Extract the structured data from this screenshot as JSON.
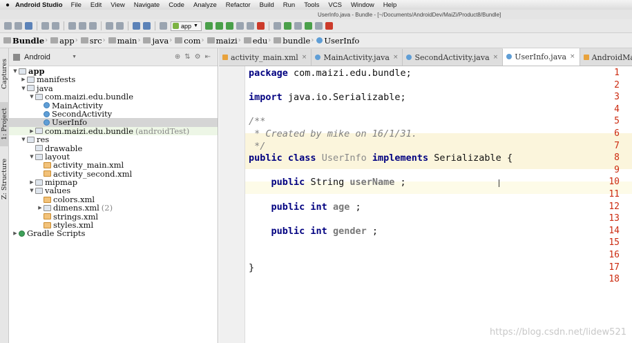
{
  "menubar": {
    "app_name": "Android Studio",
    "items": [
      "File",
      "Edit",
      "View",
      "Navigate",
      "Code",
      "Analyze",
      "Refactor",
      "Build",
      "Run",
      "Tools",
      "VCS",
      "Window",
      "Help"
    ]
  },
  "window_title": "UserInfo.java - Bundle - [~/Documents/AndroidDev/MaiZi/Product8/Bundle]",
  "toolbar": {
    "run_config": "app"
  },
  "breadcrumbs": [
    "Bundle",
    "app",
    "src",
    "main",
    "java",
    "com",
    "maizi",
    "edu",
    "bundle",
    "UserInfo"
  ],
  "side_tools": {
    "captures": "Captures",
    "project": "1: Project",
    "structure": "Z: Structure"
  },
  "project_panel": {
    "view_mode": "Android",
    "tree": [
      {
        "label": "app",
        "depth": 0,
        "arrow": "down",
        "icon": "folder",
        "bold": true
      },
      {
        "label": "manifests",
        "depth": 1,
        "arrow": "right",
        "icon": "folder"
      },
      {
        "label": "java",
        "depth": 1,
        "arrow": "down",
        "icon": "folder"
      },
      {
        "label": "com.maizi.edu.bundle",
        "depth": 2,
        "arrow": "down",
        "icon": "folder"
      },
      {
        "label": "MainActivity",
        "depth": 3,
        "arrow": "",
        "icon": "class"
      },
      {
        "label": "SecondActivity",
        "depth": 3,
        "arrow": "",
        "icon": "class"
      },
      {
        "label": "UserInfo",
        "depth": 3,
        "arrow": "",
        "icon": "class",
        "selected": true
      },
      {
        "label": "com.maizi.edu.bundle",
        "suffix": "(androidTest)",
        "depth": 2,
        "arrow": "right",
        "icon": "folder",
        "highlight": true
      },
      {
        "label": "res",
        "depth": 1,
        "arrow": "down",
        "icon": "folder"
      },
      {
        "label": "drawable",
        "depth": 2,
        "arrow": "",
        "icon": "folder"
      },
      {
        "label": "layout",
        "depth": 2,
        "arrow": "down",
        "icon": "folder"
      },
      {
        "label": "activity_main.xml",
        "depth": 3,
        "arrow": "",
        "icon": "xml"
      },
      {
        "label": "activity_second.xml",
        "depth": 3,
        "arrow": "",
        "icon": "xml"
      },
      {
        "label": "mipmap",
        "depth": 2,
        "arrow": "right",
        "icon": "folder"
      },
      {
        "label": "values",
        "depth": 2,
        "arrow": "down",
        "icon": "folder"
      },
      {
        "label": "colors.xml",
        "depth": 3,
        "arrow": "",
        "icon": "xml"
      },
      {
        "label": "dimens.xml",
        "suffix": "(2)",
        "depth": 3,
        "arrow": "right",
        "icon": "folder"
      },
      {
        "label": "strings.xml",
        "depth": 3,
        "arrow": "",
        "icon": "xml"
      },
      {
        "label": "styles.xml",
        "depth": 3,
        "arrow": "",
        "icon": "xml"
      },
      {
        "label": "Gradle Scripts",
        "depth": 0,
        "arrow": "right",
        "icon": "gradle"
      }
    ]
  },
  "editor": {
    "tabs": [
      {
        "label": "activity_main.xml",
        "icon": "xml",
        "active": false
      },
      {
        "label": "MainActivity.java",
        "icon": "class",
        "active": false
      },
      {
        "label": "SecondActivity.java",
        "icon": "class",
        "active": false
      },
      {
        "label": "UserInfo.java",
        "icon": "class",
        "active": true
      },
      {
        "label": "AndroidManifest.xml",
        "icon": "xml",
        "active": false
      }
    ],
    "lines": [
      {
        "n": "1",
        "tokens": [
          [
            "kw",
            "package"
          ],
          [
            "",
            "com.maizi.edu.bundle;"
          ]
        ]
      },
      {
        "n": "2",
        "tokens": []
      },
      {
        "n": "3",
        "tokens": [
          [
            "kw",
            "import"
          ],
          [
            "",
            "java.io.Serializable;"
          ]
        ]
      },
      {
        "n": "4",
        "tokens": []
      },
      {
        "n": "5",
        "tokens": [
          [
            "cmt",
            "/**"
          ]
        ]
      },
      {
        "n": "6",
        "tokens": [
          [
            "cmt",
            " * Created by mike on 16/1/31."
          ]
        ]
      },
      {
        "n": "7",
        "tokens": [
          [
            "cmt",
            " */"
          ]
        ]
      },
      {
        "n": "8",
        "tokens": [
          [
            "kw",
            "public class"
          ],
          [
            "cname",
            "UserInfo"
          ],
          [
            "kw",
            "implements"
          ],
          [
            "",
            "Serializable {"
          ]
        ]
      },
      {
        "n": "9",
        "tokens": []
      },
      {
        "n": "10",
        "tokens": [
          [
            "",
            "    "
          ],
          [
            "kw",
            "public"
          ],
          [
            "",
            "String"
          ],
          [
            "fld",
            "userName"
          ],
          [
            "",
            ";"
          ]
        ]
      },
      {
        "n": "11",
        "tokens": []
      },
      {
        "n": "12",
        "tokens": [
          [
            "",
            "    "
          ],
          [
            "kw",
            "public int"
          ],
          [
            "fld",
            "age"
          ],
          [
            "",
            ";"
          ]
        ]
      },
      {
        "n": "13",
        "tokens": []
      },
      {
        "n": "14",
        "tokens": [
          [
            "",
            "    "
          ],
          [
            "kw",
            "public int"
          ],
          [
            "fld",
            "gender"
          ],
          [
            "",
            ";"
          ]
        ]
      },
      {
        "n": "15",
        "tokens": []
      },
      {
        "n": "16",
        "tokens": []
      },
      {
        "n": "17",
        "tokens": [
          [
            "",
            "}"
          ]
        ]
      },
      {
        "n": "18",
        "tokens": []
      }
    ]
  },
  "watermark": "https://blog.csdn.net/lidew521",
  "colors": {
    "line_number": "#cc2b10",
    "keyword": "#000080",
    "comment": "#808080",
    "doc_band": "#fbf5dc",
    "current_line": "#fdfbe8"
  }
}
